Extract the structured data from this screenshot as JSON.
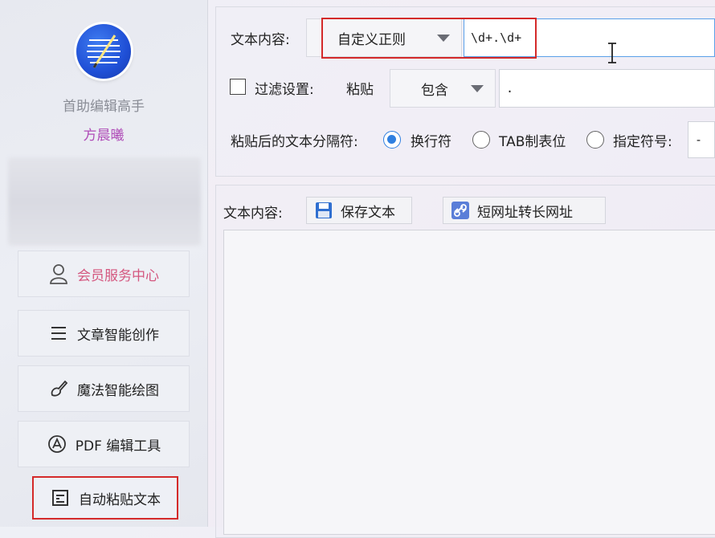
{
  "sidebar": {
    "app_name": "首助编辑高手",
    "user_name": "方晨曦",
    "items": [
      {
        "label": "会员服务中心",
        "icon": "user-icon"
      },
      {
        "label": "文章智能创作",
        "icon": "menu-lines-icon"
      },
      {
        "label": "魔法智能绘图",
        "icon": "brush-icon"
      },
      {
        "label": "PDF 编辑工具",
        "icon": "pdf-tool-icon"
      },
      {
        "label": "自动粘贴文本",
        "icon": "document-icon"
      }
    ]
  },
  "settings": {
    "content_label": "文本内容:",
    "mode_value": "自定义正则",
    "regex_value": "\\d+.\\d+",
    "filter_label": "过滤设置:",
    "paste_label": "粘贴",
    "filter_mode_value": "包含",
    "filter_text_value": ".",
    "separator_label": "粘贴后的文本分隔符:",
    "sep_newline": "换行符",
    "sep_tab": "TAB制表位",
    "sep_custom": "指定符号:",
    "sep_custom_value": "-"
  },
  "output": {
    "content_label": "文本内容:",
    "save_button": "保存文本",
    "short_url_button": "短网址转长网址"
  },
  "colors": {
    "highlight": "#d42a2a",
    "accent": "#2f7fe0",
    "vip": "#d4577f",
    "user_name": "#b04db8"
  }
}
